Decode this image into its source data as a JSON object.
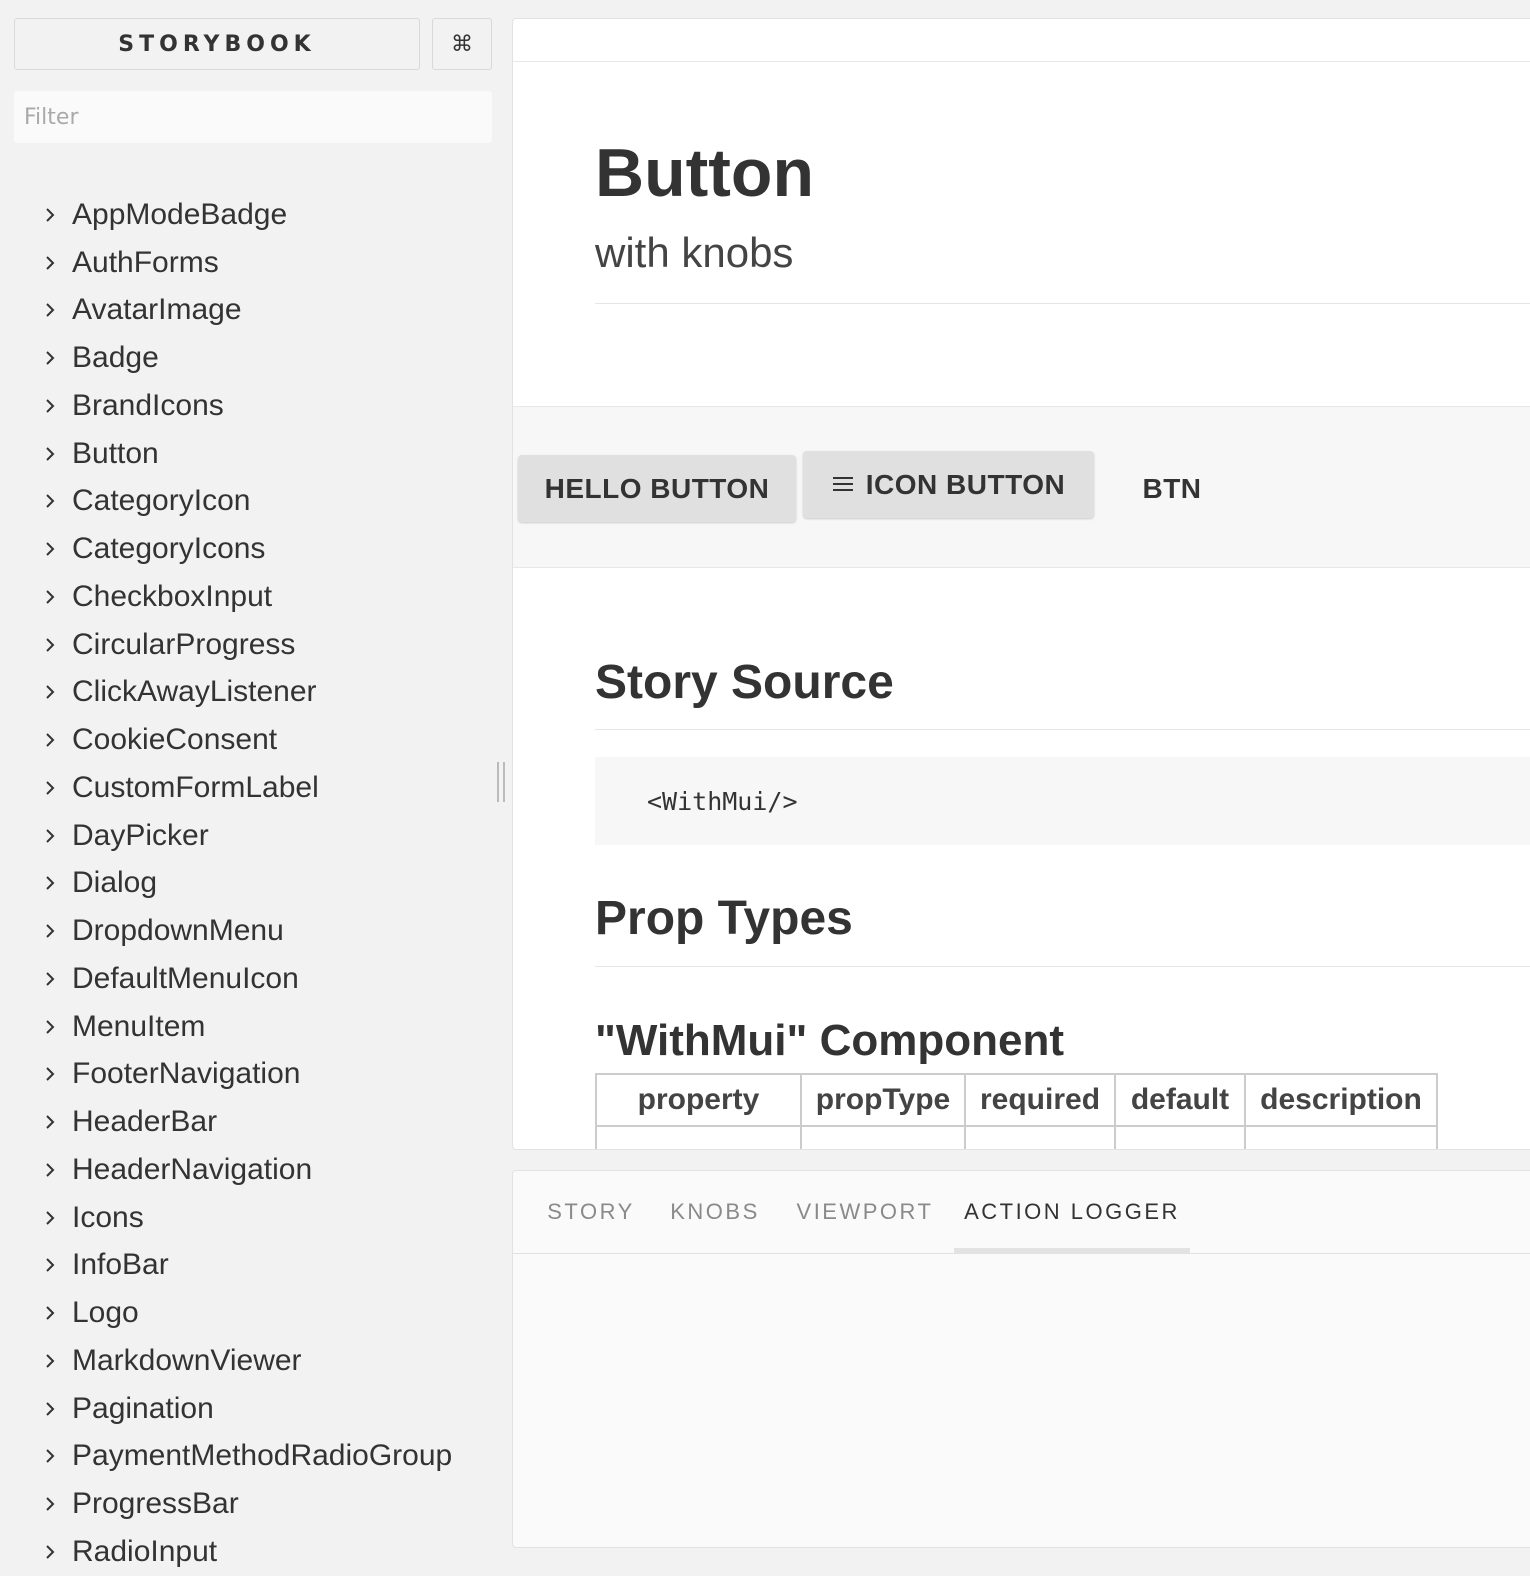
{
  "sidebar": {
    "title": "STORYBOOK",
    "shortcut_icon": "command-icon",
    "shortcut_symbol": "⌘",
    "filter": {
      "placeholder": "Filter",
      "value": ""
    },
    "items": [
      {
        "label": "AppModeBadge"
      },
      {
        "label": "AuthForms"
      },
      {
        "label": "AvatarImage"
      },
      {
        "label": "Badge"
      },
      {
        "label": "BrandIcons"
      },
      {
        "label": "Button"
      },
      {
        "label": "CategoryIcon"
      },
      {
        "label": "CategoryIcons"
      },
      {
        "label": "CheckboxInput"
      },
      {
        "label": "CircularProgress"
      },
      {
        "label": "ClickAwayListener"
      },
      {
        "label": "CookieConsent"
      },
      {
        "label": "CustomFormLabel"
      },
      {
        "label": "DayPicker"
      },
      {
        "label": "Dialog"
      },
      {
        "label": "DropdownMenu"
      },
      {
        "label": "DefaultMenuIcon"
      },
      {
        "label": "MenuItem"
      },
      {
        "label": "FooterNavigation"
      },
      {
        "label": "HeaderBar"
      },
      {
        "label": "HeaderNavigation"
      },
      {
        "label": "Icons"
      },
      {
        "label": "InfoBar"
      },
      {
        "label": "Logo"
      },
      {
        "label": "MarkdownViewer"
      },
      {
        "label": "Pagination"
      },
      {
        "label": "PaymentMethodRadioGroup"
      },
      {
        "label": "ProgressBar"
      },
      {
        "label": "RadioInput"
      }
    ]
  },
  "preview": {
    "title": "Button",
    "subtitle": "with knobs",
    "buttons": {
      "hello": "HELLO BUTTON",
      "icon": "ICON BUTTON",
      "icon_name": "menu-icon",
      "plain": "BTN"
    },
    "story_source_heading": "Story Source",
    "code": "<WithMui/>",
    "prop_types_heading": "Prop Types",
    "component_heading": "\"WithMui\" Component",
    "table": {
      "headers": [
        "property",
        "propType",
        "required",
        "default",
        "description"
      ]
    }
  },
  "addons": {
    "tabs": [
      {
        "label": "STORY",
        "active": false
      },
      {
        "label": "KNOBS",
        "active": false
      },
      {
        "label": "VIEWPORT",
        "active": false
      },
      {
        "label": "ACTION LOGGER",
        "active": true
      }
    ]
  },
  "colors": {
    "sidebar_bg": "#f2f2f2",
    "panel_bg": "#ffffff",
    "button_bg": "#e0e0e0",
    "text": "#333333",
    "muted_text": "#8a8a8a"
  }
}
